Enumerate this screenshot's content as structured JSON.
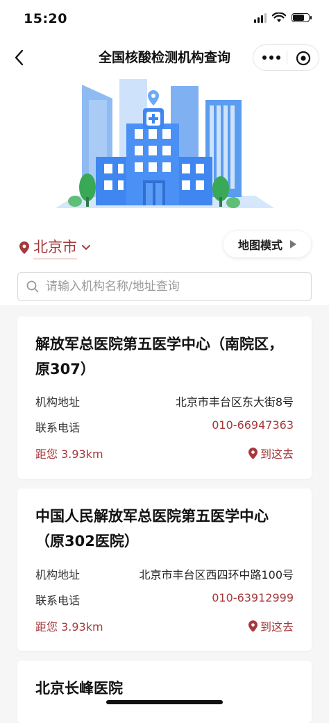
{
  "status_bar": {
    "time": "15:20"
  },
  "nav": {
    "title": "全国核酸检测机构查询"
  },
  "location": {
    "city": "北京市",
    "map_mode_label": "地图模式"
  },
  "search": {
    "placeholder": "请输入机构名称/地址查询"
  },
  "labels": {
    "address": "机构地址",
    "phone": "联系电话",
    "go": "到这去"
  },
  "institutions": [
    {
      "name": "解放军总医院第五医学中心（南院区，原307）",
      "address": "北京市丰台区东大街8号",
      "phone": "010-66947363",
      "distance": "距您 3.93km"
    },
    {
      "name": "中国人民解放军总医院第五医学中心（原302医院）",
      "address": "北京市丰台区西四环中路100号",
      "phone": "010-63912999",
      "distance": "距您 3.93km"
    },
    {
      "name": "北京长峰医院"
    }
  ],
  "colors": {
    "accent": "#a6383b",
    "building_blue": "#3f86f0",
    "tree_green": "#39a857"
  }
}
